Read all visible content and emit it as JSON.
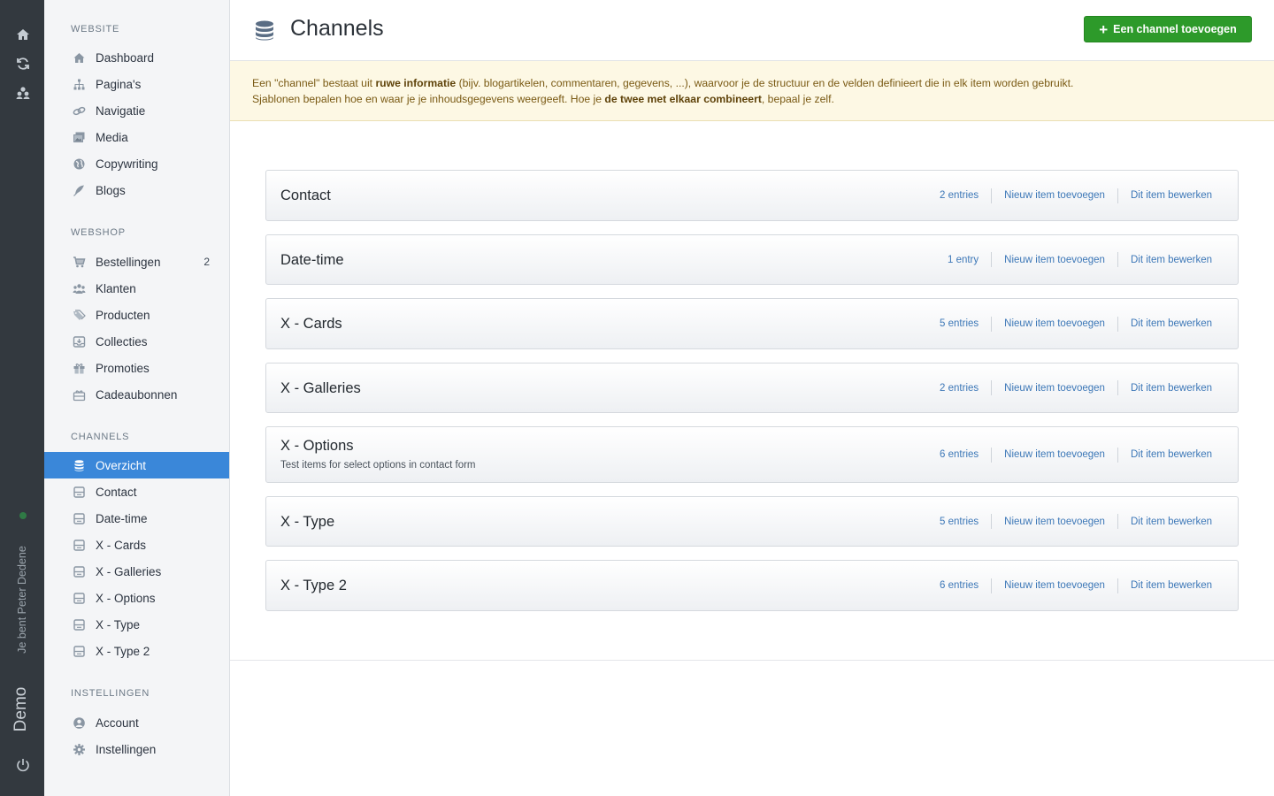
{
  "rail": {
    "user_text": "Je bent Peter Dedene",
    "brand": "Demo",
    "icons": [
      "home-icon",
      "refresh-icon",
      "users-icon",
      "power-icon"
    ],
    "status_color": "#2f7a45"
  },
  "sidebar": {
    "sections": {
      "website": "WEBSITE",
      "webshop": "WEBSHOP",
      "channels": "CHANNELS",
      "settings": "INSTELLINGEN"
    },
    "website_items": [
      "Dashboard",
      "Pagina's",
      "Navigatie",
      "Media",
      "Copywriting",
      "Blogs"
    ],
    "webshop_items": [
      "Bestellingen",
      "Klanten",
      "Producten",
      "Collecties",
      "Promoties",
      "Cadeaubonnen"
    ],
    "orders_badge": "2",
    "channel_items": [
      "Overzicht",
      "Contact",
      "Date-time",
      "X - Cards",
      "X - Galleries",
      "X - Options",
      "X - Type",
      "X - Type 2"
    ],
    "settings_items": [
      "Account",
      "Instellingen"
    ]
  },
  "header": {
    "title": "Channels",
    "add_button": "Een channel toevoegen"
  },
  "notice": {
    "p1": "Een \"channel\" bestaat uit ",
    "b1": "ruwe informatie",
    "p2": " (bijv. blogartikelen, commentaren, gegevens, ...), waarvoor je de structuur en de velden definieert die in elk item worden gebruikt.",
    "p3": "Sjablonen bepalen hoe en waar je je inhoudsgegevens weergeeft. Hoe je ",
    "b2": "de twee met elkaar combineert",
    "p4": ", bepaal je zelf."
  },
  "channels": [
    {
      "name": "Contact",
      "entries": "2 entries",
      "add": "Nieuw item toevoegen",
      "edit": "Dit item bewerken"
    },
    {
      "name": "Date-time",
      "entries": "1 entry",
      "add": "Nieuw item toevoegen",
      "edit": "Dit item bewerken"
    },
    {
      "name": "X - Cards",
      "entries": "5 entries",
      "add": "Nieuw item toevoegen",
      "edit": "Dit item bewerken"
    },
    {
      "name": "X - Galleries",
      "entries": "2 entries",
      "add": "Nieuw item toevoegen",
      "edit": "Dit item bewerken"
    },
    {
      "name": "X - Options",
      "description": "Test items for select options in contact form",
      "entries": "6 entries",
      "add": "Nieuw item toevoegen",
      "edit": "Dit item bewerken"
    },
    {
      "name": "X - Type",
      "entries": "5 entries",
      "add": "Nieuw item toevoegen",
      "edit": "Dit item bewerken"
    },
    {
      "name": "X - Type 2",
      "entries": "6 entries",
      "add": "Nieuw item toevoegen",
      "edit": "Dit item bewerken"
    }
  ],
  "colors": {
    "accent": "#3a87d9",
    "primary_button": "#2d9a2a",
    "link": "#3c77b7",
    "notice_bg": "#fdf8e4"
  }
}
